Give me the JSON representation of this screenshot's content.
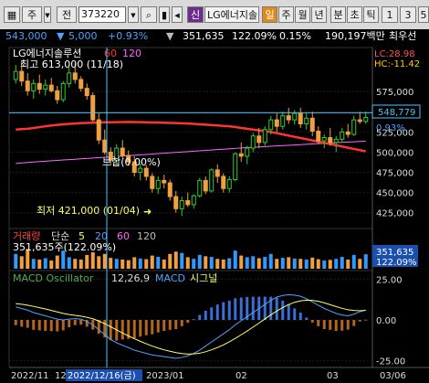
{
  "toolbar": {
    "code_type": "주",
    "market": "전",
    "code": "373220",
    "sel_button": "신",
    "name": "LG에너지솔",
    "period_buttons": [
      "일",
      "주",
      "월",
      "년",
      "분",
      "초",
      "틱"
    ],
    "period_active": "일",
    "n1": "1",
    "n2": "3"
  },
  "quote": {
    "price": "543,000",
    "change": "5,000",
    "change_pct": "+0.93%",
    "value": "351,635",
    "vol_ratio": "122.09%",
    "turnover": "0.15%",
    "amount": "190,197백만",
    "tail": "최우선"
  },
  "chart_data": {
    "type": "candlestick",
    "price_panel": {
      "title": "LG에너지솔루션",
      "ma_labels": [
        "60",
        "120"
      ],
      "ma_colors": [
        "#ff3333",
        "#ff66ff"
      ],
      "high_label": "최고 613,000 (11/18)",
      "low_label": "최저 421,000 (01/04)",
      "flat_label": "보합(0.00%)",
      "lc": "LC:28.98",
      "hc": "HC:-11.42",
      "current_price": "548,779",
      "current_pct": "0.93%",
      "ylim": [
        410000,
        625000
      ],
      "ticks": [
        "575,000",
        "550,000",
        "525,000",
        "500,000",
        "475,000",
        "450,000",
        "425,000"
      ],
      "tick_values": [
        575000,
        550000,
        525000,
        500000,
        475000,
        450000,
        425000
      ],
      "hline": 548779,
      "candles": [
        [
          590000,
          608000,
          585000,
          600000
        ],
        [
          600000,
          613000,
          582000,
          588000
        ],
        [
          588000,
          598000,
          570000,
          576000
        ],
        [
          576000,
          590000,
          566000,
          585000
        ],
        [
          585000,
          596000,
          572000,
          578000
        ],
        [
          578000,
          590000,
          570000,
          583000
        ],
        [
          583000,
          592000,
          574000,
          576000
        ],
        [
          576000,
          582000,
          560000,
          565000
        ],
        [
          565000,
          588000,
          562000,
          585000
        ],
        [
          585000,
          605000,
          580000,
          598000
        ],
        [
          598000,
          610000,
          585000,
          590000
        ],
        [
          590000,
          594000,
          575000,
          579000
        ],
        [
          579000,
          585000,
          565000,
          570000
        ],
        [
          570000,
          574000,
          538000,
          540000
        ],
        [
          540000,
          548000,
          510000,
          515000
        ],
        [
          515000,
          528000,
          497000,
          500000
        ],
        [
          500000,
          506000,
          485000,
          490000
        ],
        [
          490000,
          510000,
          485000,
          505000
        ],
        [
          505000,
          515000,
          492000,
          496000
        ],
        [
          496000,
          502000,
          483000,
          488000
        ],
        [
          488000,
          495000,
          470000,
          475000
        ],
        [
          475000,
          486000,
          465000,
          480000
        ],
        [
          480000,
          484000,
          465000,
          470000
        ],
        [
          470000,
          474000,
          450000,
          455000
        ],
        [
          455000,
          470000,
          448000,
          465000
        ],
        [
          465000,
          472000,
          455000,
          462000
        ],
        [
          462000,
          466000,
          440000,
          445000
        ],
        [
          445000,
          452000,
          425000,
          430000
        ],
        [
          430000,
          445000,
          421000,
          440000
        ],
        [
          440000,
          450000,
          432000,
          435000
        ],
        [
          435000,
          448000,
          430000,
          446000
        ],
        [
          446000,
          468000,
          444000,
          465000
        ],
        [
          465000,
          470000,
          448000,
          452000
        ],
        [
          452000,
          480000,
          450000,
          478000
        ],
        [
          478000,
          485000,
          462000,
          470000
        ],
        [
          470000,
          474000,
          450000,
          455000
        ],
        [
          455000,
          470000,
          450000,
          466000
        ],
        [
          466000,
          500000,
          464000,
          498000
        ],
        [
          498000,
          512000,
          488000,
          495000
        ],
        [
          495000,
          508000,
          485000,
          505000
        ],
        [
          505000,
          524000,
          500000,
          520000
        ],
        [
          520000,
          530000,
          505000,
          512000
        ],
        [
          512000,
          532000,
          508000,
          528000
        ],
        [
          528000,
          545000,
          522000,
          540000
        ],
        [
          540000,
          548000,
          525000,
          532000
        ],
        [
          532000,
          550000,
          528000,
          545000
        ],
        [
          545000,
          555000,
          535000,
          540000
        ],
        [
          540000,
          552000,
          534000,
          548000
        ],
        [
          548000,
          555000,
          530000,
          535000
        ],
        [
          535000,
          548000,
          528000,
          542000
        ],
        [
          542000,
          550000,
          520000,
          526000
        ],
        [
          526000,
          532000,
          510000,
          514000
        ],
        [
          514000,
          522000,
          505000,
          518000
        ],
        [
          518000,
          530000,
          508000,
          512000
        ],
        [
          512000,
          520000,
          500000,
          516000
        ],
        [
          516000,
          530000,
          512000,
          525000
        ],
        [
          525000,
          535000,
          518000,
          522000
        ],
        [
          522000,
          545000,
          520000,
          540000
        ],
        [
          540000,
          550000,
          535000,
          538000
        ],
        [
          538000,
          550000,
          535000,
          543000
        ]
      ],
      "ma60": [
        528000,
        528500,
        529000,
        530000,
        531000,
        532000,
        533000,
        533800,
        534500,
        535000,
        535500,
        536000,
        536200,
        536500,
        536800,
        537000,
        537000,
        537200,
        537300,
        537400,
        537300,
        537200,
        537000,
        536800,
        536600,
        536400,
        536200,
        536000,
        535700,
        535400,
        535000,
        534500,
        534000,
        533500,
        533000,
        532500,
        532000,
        531200,
        530000,
        529000,
        528000,
        527000,
        526000,
        525000,
        523500,
        522000,
        520500,
        519000,
        517500,
        516000,
        514500,
        513000,
        511500,
        510000,
        508500,
        507000,
        505500,
        504000,
        502500,
        501000
      ],
      "ma120": [
        486000,
        486600,
        487200,
        487800,
        488300,
        488800,
        489300,
        489800,
        490300,
        490800,
        491200,
        491700,
        492200,
        492700,
        493200,
        493700,
        494200,
        494700,
        495200,
        495700,
        496200,
        496700,
        497200,
        497700,
        498200,
        498700,
        499200,
        499700,
        500200,
        500700,
        501200,
        501700,
        502200,
        502700,
        503200,
        503700,
        504200,
        504700,
        505200,
        505700,
        506100,
        506500,
        506900,
        507300,
        507700,
        508100,
        508500,
        508900,
        509300,
        509700,
        510100,
        510500,
        510900,
        511300,
        511700,
        512100,
        512500,
        512900,
        513300,
        513700
      ]
    },
    "volume_panel": {
      "title": "거래량",
      "ma_label": "단순",
      "ma_periods": [
        "5",
        "20",
        "60",
        "120"
      ],
      "value_label": "351,635주(122.09%)",
      "badge_value": "351,635",
      "badge_pct": "122.09%",
      "values": [
        45,
        38,
        60,
        30,
        28,
        32,
        25,
        40,
        55,
        35,
        30,
        28,
        42,
        50,
        38,
        45,
        33,
        30,
        28,
        26,
        35,
        31,
        29,
        40,
        36,
        28,
        45,
        52,
        48,
        35,
        30,
        42,
        38,
        36,
        30,
        28,
        32,
        55,
        40,
        35,
        38,
        32,
        36,
        45,
        30,
        33,
        35,
        31,
        30,
        28,
        34,
        29,
        25,
        27,
        30,
        36,
        28,
        42,
        30,
        44
      ]
    },
    "macd_panel": {
      "title": "MACD Oscillator",
      "params": "12,26,9",
      "macd_label": "MACD",
      "signal_label": "시그널",
      "ylim": [
        -28,
        28
      ],
      "ticks": [
        "25.00",
        "0.00",
        "-25.00"
      ],
      "tick_values": [
        25,
        0,
        -25
      ],
      "macd": [
        8,
        7,
        6,
        4.5,
        3.5,
        2.5,
        1.5,
        0.5,
        0,
        0.5,
        0.8,
        0.5,
        -1,
        -3,
        -6,
        -9,
        -12,
        -14,
        -15.5,
        -17,
        -18.5,
        -19.5,
        -20.5,
        -21.5,
        -22,
        -22.5,
        -23,
        -23.5,
        -23,
        -22,
        -20.5,
        -18.5,
        -16,
        -13.5,
        -11,
        -8.5,
        -6,
        -3,
        -0.5,
        2,
        4.5,
        7,
        9.5,
        12,
        14,
        15,
        15.5,
        15.2,
        14.5,
        13,
        11,
        9,
        7,
        5.5,
        4,
        3,
        2.5,
        3.5,
        5,
        6
      ],
      "signal": [
        10,
        9.6,
        9,
        8.3,
        7.5,
        6.7,
        5.8,
        4.9,
        4,
        3.3,
        2.8,
        2.3,
        1.6,
        0.7,
        -0.7,
        -2.3,
        -4.2,
        -6.1,
        -8,
        -9.8,
        -11.5,
        -13.1,
        -14.6,
        -16,
        -17.2,
        -18.3,
        -19.2,
        -20,
        -20.6,
        -20.9,
        -20.8,
        -20.4,
        -19.5,
        -18.3,
        -16.9,
        -15.3,
        -13.4,
        -11.3,
        -9.1,
        -6.8,
        -4.4,
        -1.9,
        0.6,
        3.1,
        5.5,
        7.6,
        9.4,
        10.8,
        11.7,
        12.1,
        12,
        11.4,
        10.5,
        9.3,
        8.2,
        7.1,
        6.2,
        5.8,
        5.6,
        5.9
      ]
    },
    "x_axis": {
      "labels": [
        "2022/11",
        "12",
        "2022/12/16(금)",
        "2023/01",
        "02",
        "03",
        "03/06"
      ]
    }
  }
}
